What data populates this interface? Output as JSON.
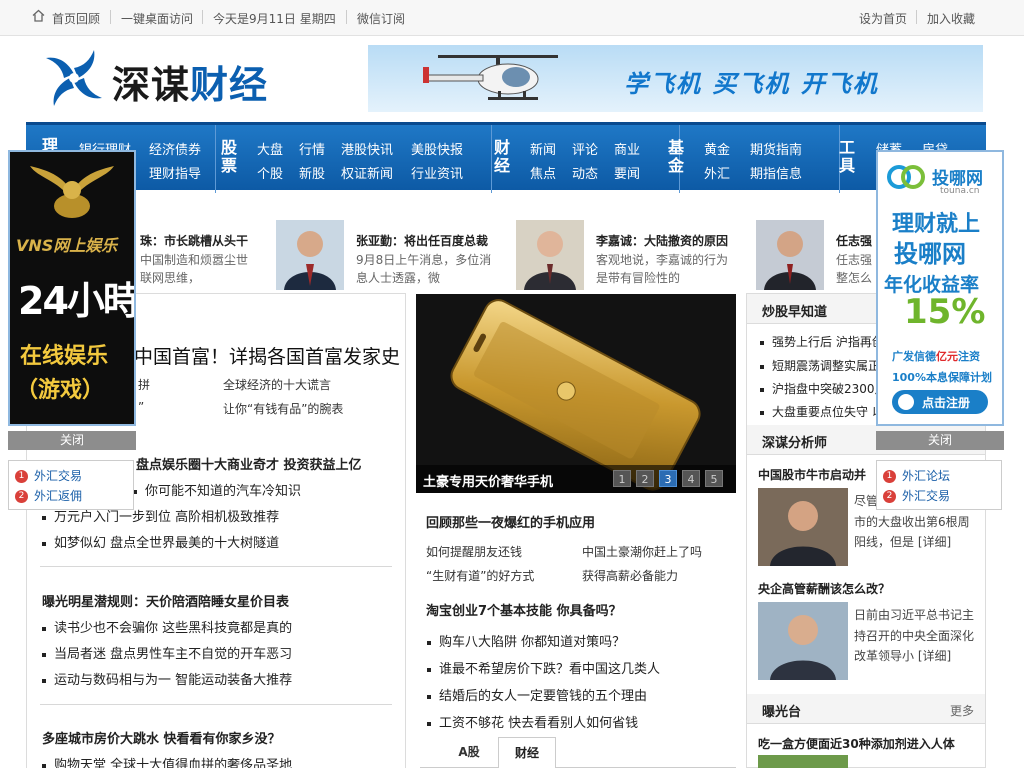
{
  "topbar": {
    "home": "首页回顾",
    "desktop": "一键桌面访问",
    "date": "今天是9月11日 星期四",
    "weixin": "微信订阅",
    "set_home": "设为首页",
    "favorite": "加入收藏"
  },
  "header": {
    "logo_text_a": "深谋",
    "logo_text_b": "财经",
    "banner_text": "学飞机 买飞机 开飞机"
  },
  "nav": {
    "cat_licai": "理",
    "licai_links": [
      "银行理财",
      "经济债券",
      "理财指导"
    ],
    "cat_gupiao": "股票",
    "gupiao_links": [
      "大盘",
      "行情",
      "港股快讯",
      "美股快报",
      "个股",
      "新股",
      "权证新闻",
      "行业资讯"
    ],
    "cat_caijing": "财经",
    "caijing_links": [
      "新闻",
      "评论",
      "商业",
      "焦点",
      "动态",
      "要闻"
    ],
    "cat_jijin": "基金",
    "jijin_links": [
      "黄金",
      "期货指南",
      "外汇",
      "期指信息"
    ],
    "cat_gongju": "工具",
    "gongju_links": [
      "储蓄",
      "房贷"
    ]
  },
  "left_ad": {
    "brand": "VNS网上娱乐",
    "line1": "24小時",
    "line2": "在线娱乐",
    "line3": "（游戏）",
    "close": "关闭",
    "links": [
      "外汇交易",
      "外汇返佣"
    ]
  },
  "right_ad": {
    "brand": "投哪网",
    "domain": "touna.cn",
    "line1": "理财就上",
    "line2": "投哪网",
    "line3": "年化收益率",
    "rate": "15%",
    "line4a": "广发信德",
    "line4b": "亿元",
    "line4c": "注资",
    "line5": "100%本息保障计划",
    "register": "点击注册",
    "close": "关闭",
    "links": [
      "外汇论坛",
      "外汇交易"
    ]
  },
  "people": [
    {
      "name": "珠：市长跳槽从头干",
      "desc": [
        "中国制造和烦嚣尘世",
        "联网思维，"
      ]
    },
    {
      "name": "张亚勤：将出任百度总裁",
      "desc": [
        "9月8日上午消息，多位消",
        "息人士透露，微"
      ]
    },
    {
      "name": "李嘉诚：大陆撤资的原因",
      "desc": [
        "客观地说，李嘉诚的行为",
        "是带有冒险性的"
      ]
    },
    {
      "name": "任志强",
      "desc": [
        "任志强",
        "整怎么"
      ]
    }
  ],
  "left_col": {
    "headline": "中国首富！详揭各国首富发家史",
    "row1": [
      "拼",
      "全球经济的十大谎言"
    ],
    "row2": [
      "”",
      "让你“有钱有品”的腕表"
    ],
    "sec2_title": "盘点娱乐圈十大商业奇才 投资获益上亿",
    "sec2_items": [
      "你可能不知道的汽车冷知识",
      "万元户入门一步到位 高阶相机极致推荐",
      "如梦似幻 盘点全世界最美的十大树隧道"
    ],
    "sec3_title": "曝光明星潜规则：天价陪酒陪睡女星价目表",
    "sec3_items": [
      "读书少也不会骗你 这些黑科技竟都是真的",
      "当局者迷 盘点男性车主不自觉的开车恶习",
      "运动与数码相与为一 智能运动装备大推荐"
    ],
    "sec4_title": "多座城市房价大跳水 快看看有你家乡没？",
    "sec4_items": [
      "购物天堂 全球十大值得血拼的奢侈品圣地"
    ]
  },
  "center": {
    "photo_caption": "土豪专用天价奢华手机",
    "pages": [
      "1",
      "2",
      "3",
      "4",
      "5"
    ],
    "active_page": "3",
    "sec1_title": "回顾那些一夜爆红的手机应用",
    "sec1_rows": [
      [
        "如何提醒朋友还钱",
        "中国土豪潮你赶上了吗"
      ],
      [
        "“生财有道”的好方式",
        "获得高薪必备能力"
      ]
    ],
    "sec2_title": "淘宝创业7个基本技能 你具备吗？",
    "sec2_items": [
      "购车八大陷阱 你都知道对策吗？",
      "谁最不希望房价下跌？看中国这几类人",
      "结婚后的女人一定要管钱的五个理由",
      "工资不够花 快去看看别人如何省钱"
    ],
    "tabs": [
      "A股",
      "财经"
    ]
  },
  "right_col": {
    "zaozhidao_title": "炒股早知道",
    "zaozhidao_items": [
      "强势上行后 沪指再创",
      "短期震荡调整实属正",
      "沪指盘中突破2300点",
      "大盘重要点位失守 以"
    ],
    "fenxi_title": "深谋分析师",
    "fenxi1_title": "中国股市牛市启动并",
    "fenxi1_desc": [
      "尽管",
      "市的大盘收出第6根周",
      "阳线，但是 [详细]"
    ],
    "fenxi2_title": "央企高管薪酬该怎么改？",
    "fenxi2_desc": [
      "日前由习近平总书记主",
      "持召开的中央全面深化",
      "改革领导小 [详细]"
    ],
    "baoguang_title": "曝光台",
    "more": "更多",
    "baoguang_item": "吃一盒方便面近30种添加剂进入人体"
  }
}
